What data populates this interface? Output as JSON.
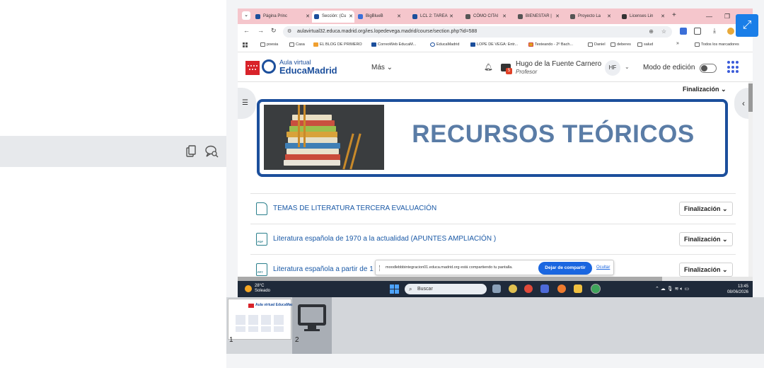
{
  "browser": {
    "tabs": [
      {
        "label": "Página Princ",
        "color": "#1c4f9c"
      },
      {
        "label": "Sección: (Cu",
        "color": "#1c4f9c",
        "active": true
      },
      {
        "label": "BigBlueB",
        "color": "#3b6fd8"
      },
      {
        "label": "LCL 2: TAREA",
        "color": "#1c4f9c"
      },
      {
        "label": "CÓMO CITAI",
        "color": "#555"
      },
      {
        "label": "BIENESTAR |",
        "color": "#555"
      },
      {
        "label": "Proyecto La",
        "color": "#555"
      },
      {
        "label": "Licenses Lin",
        "color": "#333"
      }
    ],
    "new_tab": "+",
    "window_controls": [
      "—",
      "❐"
    ],
    "url": "aulavirtual32.educa.madrid.org/ies.lopedevega.madrid/course/section.php?id=588",
    "bookmarks": [
      "poesia",
      "Casa",
      "EL BLOG DE PRIMERO",
      "CorreoWeb EducaM...",
      "EducaMadrid",
      "LOPE DE VEGA: Entr...",
      "Testeando - 2º Bach...",
      "Daniel",
      "deberes",
      "salud",
      "»",
      "Todos los marcadores"
    ]
  },
  "site": {
    "logo_top": "Aula virtual",
    "logo_bottom": "EducaMadrid",
    "more_menu": "Más ⌄",
    "notif_badge": "5",
    "user_name": "Hugo de la Fuente Carnero",
    "user_role": "Profesor",
    "user_initials": "HF",
    "edit_mode_label": "Modo de edición",
    "top_completion": "Finalización ⌄",
    "banner_title": "RECURSOS TEÓRICOS",
    "activities": [
      {
        "label": "TEMAS DE LITERATURA TERCERA EVALUACIÓN",
        "type": "folder",
        "completion": "Finalización ⌄"
      },
      {
        "label": "Literatura española de 1970 a la actualidad (APUNTES AMPLIACIÓN )",
        "type": "pdf",
        "completion": "Finalización ⌄"
      },
      {
        "label": "Literatura española a partir de 1",
        "type": "ppt",
        "completion": "Finalización ⌄"
      }
    ]
  },
  "share_notice": {
    "text": "moodlebbbintegracion01.educa.madrid.org está compartiendo tu pantalla.",
    "stop_label": "Dejar de compartir",
    "hide_label": "Ocultar"
  },
  "taskbar": {
    "weather_temp": "28°C",
    "weather_desc": "Soleado",
    "search_placeholder": "Buscar",
    "time": "13:45",
    "date": "08/06/2026"
  },
  "thumbnails": [
    {
      "number": "1",
      "preview_title": "Aula virtual EducaMadrid"
    },
    {
      "number": "2"
    }
  ]
}
